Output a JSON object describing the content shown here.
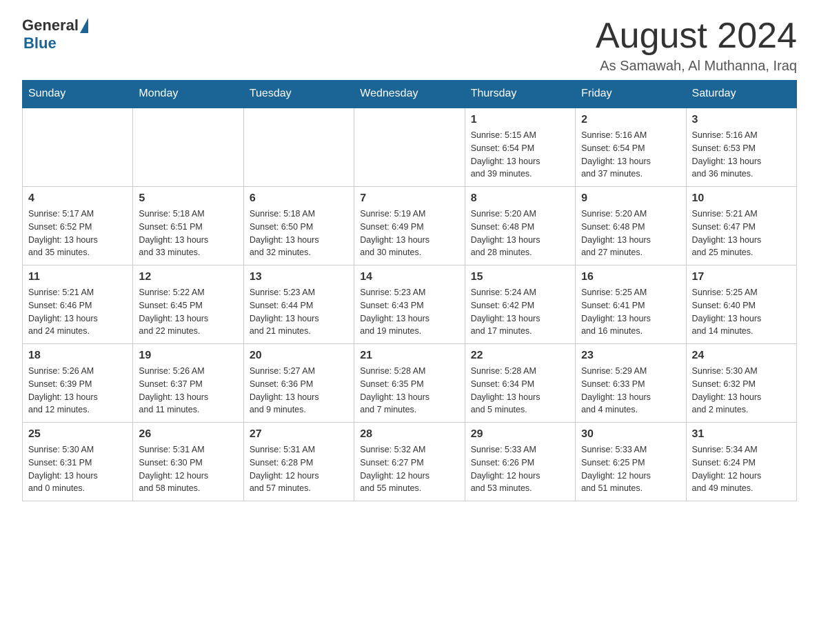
{
  "header": {
    "logo_general": "General",
    "logo_blue": "Blue",
    "month_title": "August 2024",
    "location": "As Samawah, Al Muthanna, Iraq"
  },
  "weekdays": [
    "Sunday",
    "Monday",
    "Tuesday",
    "Wednesday",
    "Thursday",
    "Friday",
    "Saturday"
  ],
  "weeks": [
    [
      {
        "day": "",
        "info": ""
      },
      {
        "day": "",
        "info": ""
      },
      {
        "day": "",
        "info": ""
      },
      {
        "day": "",
        "info": ""
      },
      {
        "day": "1",
        "info": "Sunrise: 5:15 AM\nSunset: 6:54 PM\nDaylight: 13 hours\nand 39 minutes."
      },
      {
        "day": "2",
        "info": "Sunrise: 5:16 AM\nSunset: 6:54 PM\nDaylight: 13 hours\nand 37 minutes."
      },
      {
        "day": "3",
        "info": "Sunrise: 5:16 AM\nSunset: 6:53 PM\nDaylight: 13 hours\nand 36 minutes."
      }
    ],
    [
      {
        "day": "4",
        "info": "Sunrise: 5:17 AM\nSunset: 6:52 PM\nDaylight: 13 hours\nand 35 minutes."
      },
      {
        "day": "5",
        "info": "Sunrise: 5:18 AM\nSunset: 6:51 PM\nDaylight: 13 hours\nand 33 minutes."
      },
      {
        "day": "6",
        "info": "Sunrise: 5:18 AM\nSunset: 6:50 PM\nDaylight: 13 hours\nand 32 minutes."
      },
      {
        "day": "7",
        "info": "Sunrise: 5:19 AM\nSunset: 6:49 PM\nDaylight: 13 hours\nand 30 minutes."
      },
      {
        "day": "8",
        "info": "Sunrise: 5:20 AM\nSunset: 6:48 PM\nDaylight: 13 hours\nand 28 minutes."
      },
      {
        "day": "9",
        "info": "Sunrise: 5:20 AM\nSunset: 6:48 PM\nDaylight: 13 hours\nand 27 minutes."
      },
      {
        "day": "10",
        "info": "Sunrise: 5:21 AM\nSunset: 6:47 PM\nDaylight: 13 hours\nand 25 minutes."
      }
    ],
    [
      {
        "day": "11",
        "info": "Sunrise: 5:21 AM\nSunset: 6:46 PM\nDaylight: 13 hours\nand 24 minutes."
      },
      {
        "day": "12",
        "info": "Sunrise: 5:22 AM\nSunset: 6:45 PM\nDaylight: 13 hours\nand 22 minutes."
      },
      {
        "day": "13",
        "info": "Sunrise: 5:23 AM\nSunset: 6:44 PM\nDaylight: 13 hours\nand 21 minutes."
      },
      {
        "day": "14",
        "info": "Sunrise: 5:23 AM\nSunset: 6:43 PM\nDaylight: 13 hours\nand 19 minutes."
      },
      {
        "day": "15",
        "info": "Sunrise: 5:24 AM\nSunset: 6:42 PM\nDaylight: 13 hours\nand 17 minutes."
      },
      {
        "day": "16",
        "info": "Sunrise: 5:25 AM\nSunset: 6:41 PM\nDaylight: 13 hours\nand 16 minutes."
      },
      {
        "day": "17",
        "info": "Sunrise: 5:25 AM\nSunset: 6:40 PM\nDaylight: 13 hours\nand 14 minutes."
      }
    ],
    [
      {
        "day": "18",
        "info": "Sunrise: 5:26 AM\nSunset: 6:39 PM\nDaylight: 13 hours\nand 12 minutes."
      },
      {
        "day": "19",
        "info": "Sunrise: 5:26 AM\nSunset: 6:37 PM\nDaylight: 13 hours\nand 11 minutes."
      },
      {
        "day": "20",
        "info": "Sunrise: 5:27 AM\nSunset: 6:36 PM\nDaylight: 13 hours\nand 9 minutes."
      },
      {
        "day": "21",
        "info": "Sunrise: 5:28 AM\nSunset: 6:35 PM\nDaylight: 13 hours\nand 7 minutes."
      },
      {
        "day": "22",
        "info": "Sunrise: 5:28 AM\nSunset: 6:34 PM\nDaylight: 13 hours\nand 5 minutes."
      },
      {
        "day": "23",
        "info": "Sunrise: 5:29 AM\nSunset: 6:33 PM\nDaylight: 13 hours\nand 4 minutes."
      },
      {
        "day": "24",
        "info": "Sunrise: 5:30 AM\nSunset: 6:32 PM\nDaylight: 13 hours\nand 2 minutes."
      }
    ],
    [
      {
        "day": "25",
        "info": "Sunrise: 5:30 AM\nSunset: 6:31 PM\nDaylight: 13 hours\nand 0 minutes."
      },
      {
        "day": "26",
        "info": "Sunrise: 5:31 AM\nSunset: 6:30 PM\nDaylight: 12 hours\nand 58 minutes."
      },
      {
        "day": "27",
        "info": "Sunrise: 5:31 AM\nSunset: 6:28 PM\nDaylight: 12 hours\nand 57 minutes."
      },
      {
        "day": "28",
        "info": "Sunrise: 5:32 AM\nSunset: 6:27 PM\nDaylight: 12 hours\nand 55 minutes."
      },
      {
        "day": "29",
        "info": "Sunrise: 5:33 AM\nSunset: 6:26 PM\nDaylight: 12 hours\nand 53 minutes."
      },
      {
        "day": "30",
        "info": "Sunrise: 5:33 AM\nSunset: 6:25 PM\nDaylight: 12 hours\nand 51 minutes."
      },
      {
        "day": "31",
        "info": "Sunrise: 5:34 AM\nSunset: 6:24 PM\nDaylight: 12 hours\nand 49 minutes."
      }
    ]
  ]
}
